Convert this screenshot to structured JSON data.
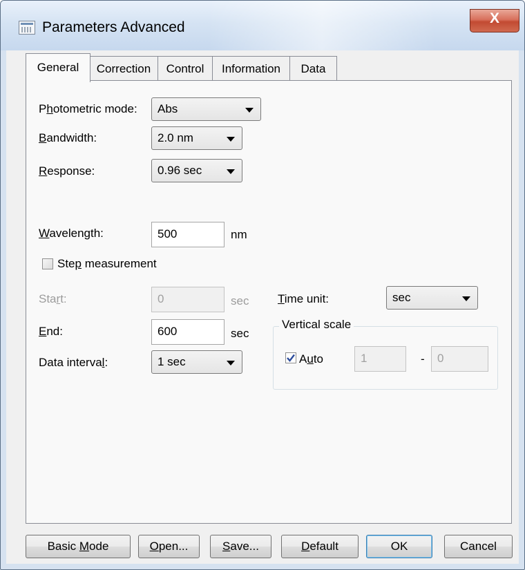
{
  "window": {
    "title": "Parameters  Advanced",
    "close_glyph": "X"
  },
  "tabs": [
    {
      "label": "General",
      "active": true
    },
    {
      "label": "Correction",
      "active": false
    },
    {
      "label": "Control",
      "active": false
    },
    {
      "label": "Information",
      "active": false
    },
    {
      "label": "Data",
      "active": false
    }
  ],
  "general": {
    "photometric_mode": {
      "label_pre": "P",
      "label_key": "h",
      "label_post": "otometric mode:",
      "value": "Abs"
    },
    "bandwidth": {
      "label_pre": "",
      "label_key": "B",
      "label_post": "andwidth:",
      "value": "2.0 nm"
    },
    "response": {
      "label_pre": "",
      "label_key": "R",
      "label_post": "esponse:",
      "value": "0.96 sec"
    },
    "wavelength": {
      "label_pre": "",
      "label_key": "W",
      "label_post": "avelength:",
      "value": "500",
      "unit": "nm"
    },
    "step_measurement": {
      "label_pre": "Ste",
      "label_key": "p",
      "label_post": " measurement",
      "checked": false
    },
    "start": {
      "label_pre": "Sta",
      "label_key": "r",
      "label_post": "t:",
      "value": "0",
      "unit": "sec",
      "disabled": true
    },
    "end": {
      "label_pre": "",
      "label_key": "E",
      "label_post": "nd:",
      "value": "600",
      "unit": "sec"
    },
    "data_interval": {
      "label_pre": "Data interva",
      "label_key": "l",
      "label_post": ":",
      "value": "1 sec"
    },
    "time_unit": {
      "label_pre": "",
      "label_key": "T",
      "label_post": "ime unit:",
      "value": "sec"
    },
    "vertical_scale": {
      "title": "Vertical scale",
      "auto": {
        "label_pre": "A",
        "label_key": "u",
        "label_post": "to",
        "checked": true
      },
      "min": "1",
      "separator": "-",
      "max": "0"
    }
  },
  "buttons": {
    "basic_mode": {
      "pre": "Basic ",
      "key": "M",
      "post": "ode"
    },
    "open": {
      "pre": "",
      "key": "O",
      "post": "pen..."
    },
    "save": {
      "pre": "",
      "key": "S",
      "post": "ave..."
    },
    "default": {
      "pre": "",
      "key": "D",
      "post": "efault"
    },
    "ok": {
      "pre": "",
      "key": "",
      "post": "OK"
    },
    "cancel": {
      "pre": "",
      "key": "",
      "post": "Cancel"
    }
  },
  "colors": {
    "title_bar": "#d5e3f3",
    "close_button": "#c24a32",
    "dialog_bg": "#f0f0f0",
    "tab_panel_bg": "#f9f9f9",
    "check_mark": "#2b4b9b"
  },
  "icons": {
    "app": "window-grid-icon",
    "close": "close-icon",
    "dropdown": "chevron-down-icon",
    "check": "checkmark-icon"
  }
}
